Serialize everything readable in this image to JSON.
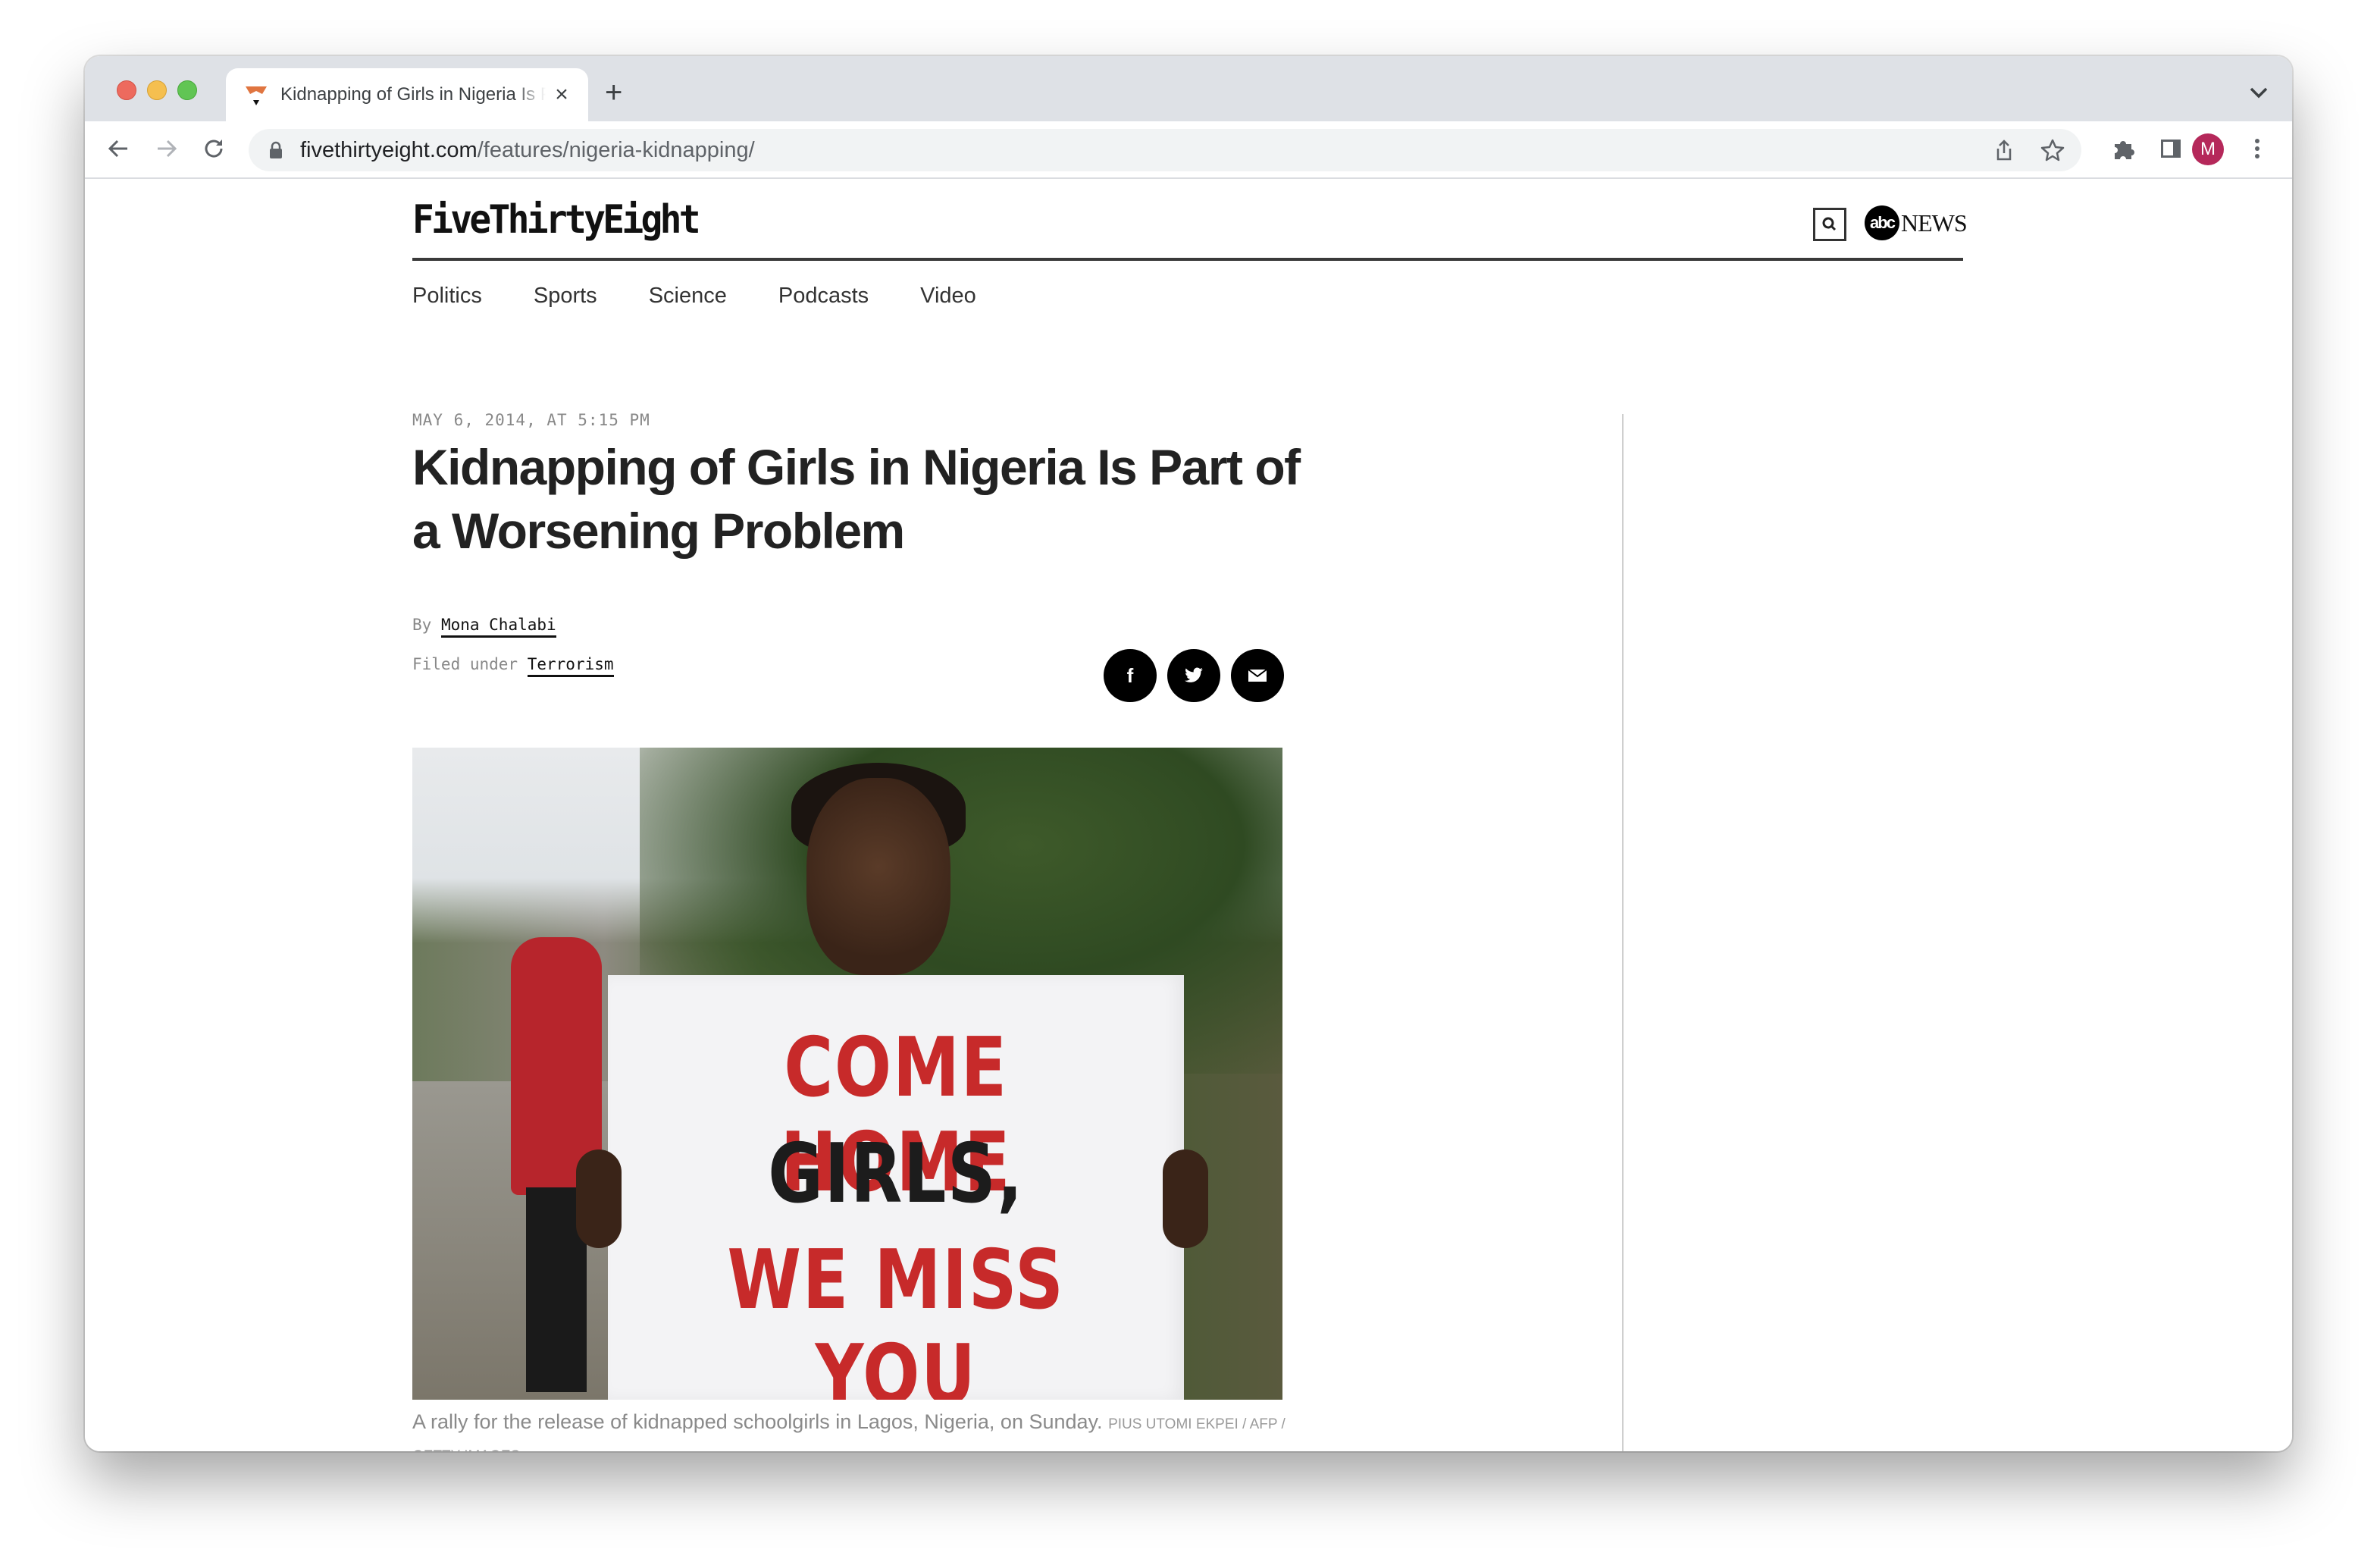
{
  "browser": {
    "tab": {
      "title": "Kidnapping of Girls in Nigeria Is Part of a Worsening Problem",
      "close_label": "×"
    },
    "new_tab_label": "+",
    "url": {
      "host": "fivethirtyeight.com",
      "path": "/features/nigeria-kidnapping/"
    },
    "profile_initial": "M",
    "colors": {
      "avatar": "#b5285a",
      "favicon": "#e07540"
    }
  },
  "site": {
    "logo": "FiveThirtyEight",
    "partner": {
      "circle": "abc",
      "word": "NEWS"
    },
    "nav": [
      {
        "label": "Politics"
      },
      {
        "label": "Sports"
      },
      {
        "label": "Science"
      },
      {
        "label": "Podcasts"
      },
      {
        "label": "Video"
      }
    ]
  },
  "article": {
    "date": "MAY 6, 2014, AT 5:15 PM",
    "headline": "Kidnapping of Girls in Nigeria Is Part of a Worsening Problem",
    "by_prefix": "By",
    "author": "Mona Chalabi",
    "filed_prefix": "Filed under",
    "topic": "Terrorism",
    "share": [
      {
        "icon": "facebook-icon",
        "glyph": "f"
      },
      {
        "icon": "twitter-icon",
        "glyph": ""
      },
      {
        "icon": "email-icon",
        "glyph": ""
      }
    ],
    "image": {
      "alt": "Protester holding sign reading COME HOME GIRLS, WE MISS YOU",
      "sign_lines": [
        "COME HOME",
        "GIRLS,",
        "WE MISS YOU"
      ]
    },
    "caption": "A rally for the release of kidnapped schoolgirls in Lagos, Nigeria, on Sunday.",
    "credit": "Pius Utomi Ekpei / AFP / Getty Images"
  }
}
